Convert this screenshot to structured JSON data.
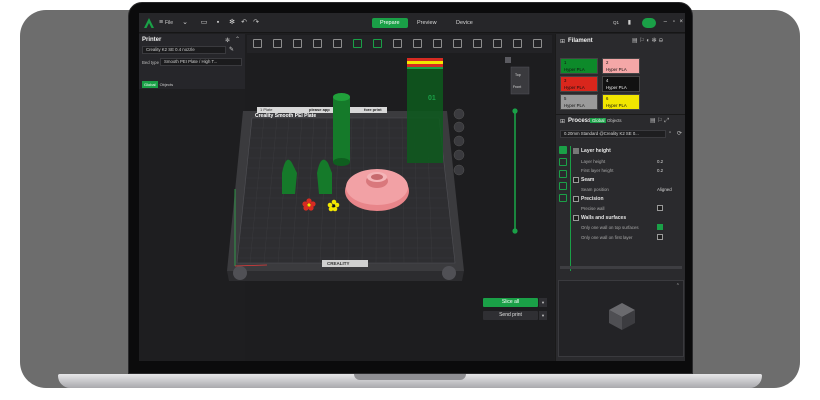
{
  "app": {
    "menu_file": "File",
    "tabs": [
      {
        "label": "Prepare",
        "active": true
      },
      {
        "label": "Preview",
        "active": false
      },
      {
        "label": "Device",
        "active": false
      }
    ],
    "accent": "#1aa047",
    "help_label": "Q1"
  },
  "left_panel": {
    "printer_title": "Printer",
    "printer_value": "Creality K2 SE 0.4 nozzle",
    "bed_type_label": "Bed type",
    "bed_type_value": "Smooth PEI Plate / High T...",
    "tabs": [
      {
        "label": "Global",
        "active": true
      },
      {
        "label": "Objects",
        "active": false
      }
    ]
  },
  "viewport": {
    "plate_label": "1 Plate",
    "plate_name": "Creality Smooth PEI Plate",
    "plate_hint_1": "please app",
    "plate_hint_2": "fore print",
    "bed_logo": "CREALITY",
    "view_top": "Top",
    "view_front": "Front",
    "object_number": "01"
  },
  "right_panel": {
    "filament_title": "Filament",
    "filaments": [
      {
        "num": "1",
        "name": "Hyper PLA",
        "color": "#0d8a2a",
        "dark_text": false
      },
      {
        "num": "2",
        "name": "Hyper PLA",
        "color": "#f4a7a7",
        "dark_text": false
      },
      {
        "num": "3",
        "name": "Hyper PLA",
        "color": "#d9261c",
        "dark_text": false
      },
      {
        "num": "4",
        "name": "Hyper PLA",
        "color": "#111111",
        "dark_text": true
      },
      {
        "num": "5",
        "name": "Hyper PLA",
        "color": "#9a9a9a",
        "dark_text": false
      },
      {
        "num": "6",
        "name": "Hyper PLA",
        "color": "#f2e600",
        "dark_text": false
      }
    ],
    "process_title": "Process",
    "process_tabs": [
      {
        "label": "Global",
        "active": true
      },
      {
        "label": "Objects",
        "active": false
      }
    ],
    "process_preset": "0.20mm Standard @Creality K2 SE 0...",
    "sections": {
      "layer_height": {
        "title": "Layer height",
        "layer_height_label": "Layer height",
        "layer_height_value": "0.2",
        "first_layer_label": "First layer height",
        "first_layer_value": "0.2"
      },
      "seam": {
        "title": "Seam",
        "position_label": "Seam position",
        "position_value": "Aligned"
      },
      "precision": {
        "title": "Precision",
        "precise_wall_label": "Precise wall",
        "precise_wall_checked": false
      },
      "walls": {
        "title": "Walls and surfaces",
        "top_surface_label": "Only one wall on top surfaces",
        "top_surface_checked": true,
        "first_layer_label": "Only one wall on first layer",
        "first_layer_checked": false
      }
    }
  },
  "actions": {
    "slice_all": "Slice all",
    "send_print": "Send print"
  }
}
